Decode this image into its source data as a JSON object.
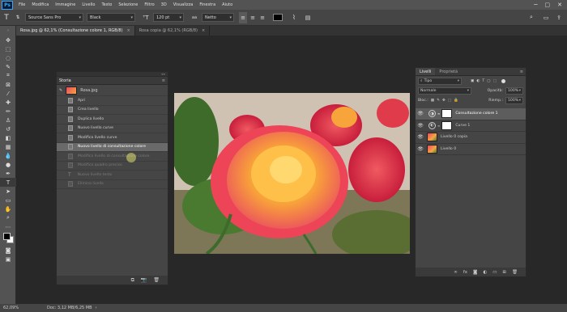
{
  "menubar": {
    "logo": "Ps",
    "items": [
      "File",
      "Modifica",
      "Immagine",
      "Livello",
      "Testo",
      "Selezione",
      "Filtro",
      "3D",
      "Visualizza",
      "Finestra",
      "Aiuto"
    ],
    "window_controls": [
      "─",
      "▢",
      "✕"
    ]
  },
  "options": {
    "font_family": "Source Sans Pro",
    "font_style": "Black",
    "font_size": "120 pt",
    "aa_label": "aa",
    "antialias": "Netto"
  },
  "tabs": [
    {
      "label": "Rosa.jpg @ 62,1% (Consultazione colore 1, RGB/8)",
      "close": "×"
    },
    {
      "label": "Rosa copia @ 62,1% (RGB/8)",
      "close": "×"
    }
  ],
  "history": {
    "title": "Storia",
    "snapshot": "Rosa.jpg",
    "steps": [
      {
        "label": "Apri",
        "state": "normal"
      },
      {
        "label": "Crea livello",
        "state": "normal"
      },
      {
        "label": "Duplica livello",
        "state": "normal"
      },
      {
        "label": "Nuovo livello curve",
        "state": "normal"
      },
      {
        "label": "Modifica livello curve",
        "state": "normal"
      },
      {
        "label": "Nuovo livello di consultazione colore",
        "state": "selected"
      },
      {
        "label": "Modifica livello di consultazione colore",
        "state": "dim"
      },
      {
        "label": "Modifica quadro preciso",
        "state": "dim"
      },
      {
        "label": "Nuovo livello testo",
        "state": "dim"
      },
      {
        "label": "Elimina livello",
        "state": "dim"
      }
    ]
  },
  "layers": {
    "tabs": [
      "Livelli",
      "Proprietà"
    ],
    "filter": "Tipo",
    "blend_mode": "Normale",
    "opacity_label": "Opacità:",
    "opacity": "100%",
    "lock_label": "Bloc.:",
    "fill_label": "Riemp.:",
    "fill": "100%",
    "items": [
      {
        "name": "Consultazione colore 1",
        "kind": "adjustment",
        "active": true
      },
      {
        "name": "Curve 1",
        "kind": "adjustment",
        "active": false
      },
      {
        "name": "Livello 0 copia",
        "kind": "image",
        "active": false
      },
      {
        "name": "Livello 0",
        "kind": "image",
        "active": false
      }
    ]
  },
  "status": {
    "zoom": "62,09%",
    "doc": "Doc: 3,12 MB/6,25 MB"
  }
}
